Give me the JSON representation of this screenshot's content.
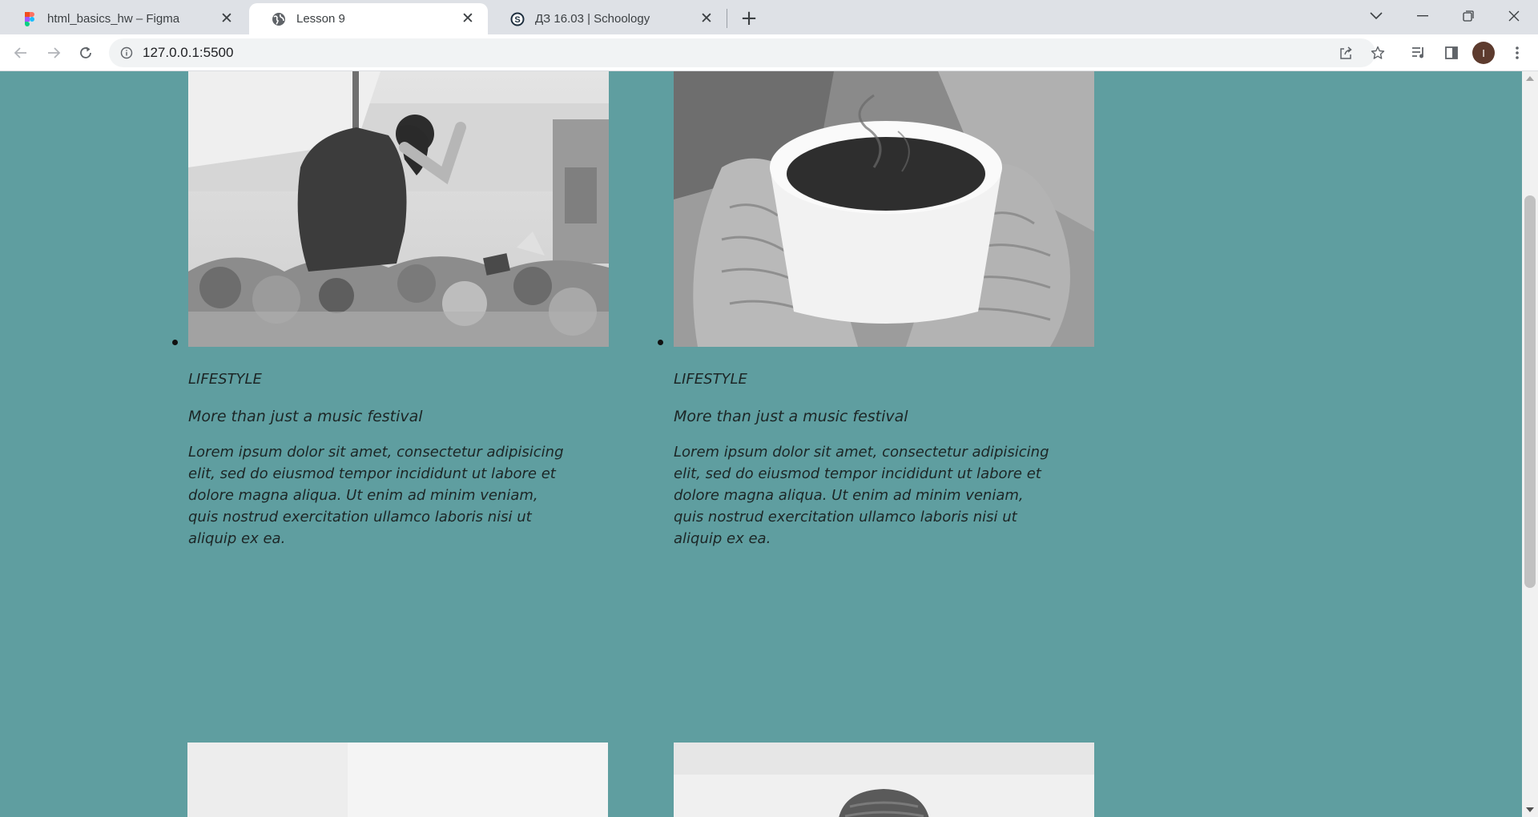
{
  "browser": {
    "tabs": [
      {
        "title": "html_basics_hw – Figma",
        "icon": "figma-icon",
        "active": false
      },
      {
        "title": "Lesson 9",
        "icon": "globe-icon",
        "active": true
      },
      {
        "title": "ДЗ 16.03 | Schoology",
        "icon": "schoology-icon",
        "active": false
      }
    ],
    "url": "127.0.0.1:5500",
    "profile_initial": "I"
  },
  "page": {
    "background_color": "#5f9ea0",
    "cards": [
      {
        "category": "LIFESTYLE",
        "title": "More than just a music festival",
        "text": "Lorem ipsum dolor sit amet, consectetur adipisicing elit, sed do eiusmod tempor incididunt ut labore et dolore magna aliqua. Ut enim ad minim veniam, quis nostrud exercitation ullamco laboris nisi ut aliquip ex ea."
      },
      {
        "category": "LIFESTYLE",
        "title": "More than just a music festival",
        "text": "Lorem ipsum dolor sit amet, consectetur adipisicing elit, sed do eiusmod tempor incididunt ut labore et dolore magna aliqua. Ut enim ad minim veniam, quis nostrud exercitation ullamco laboris nisi ut aliquip ex ea."
      }
    ]
  }
}
